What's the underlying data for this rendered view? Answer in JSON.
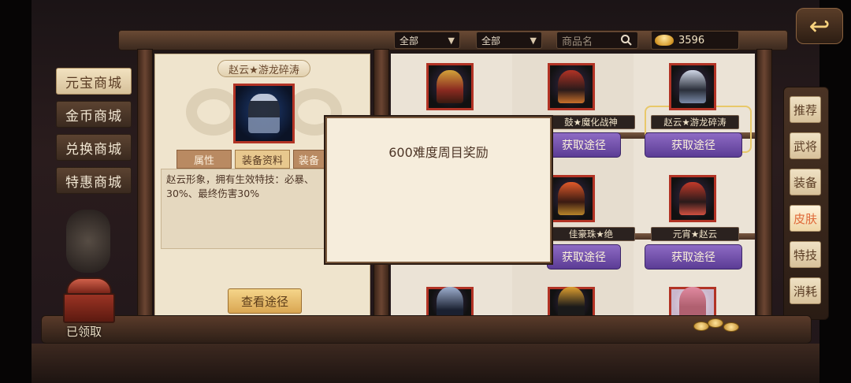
{
  "top": {
    "filter1": "全部",
    "filter2": "全部",
    "search_placeholder": "商品名",
    "currency_amount": "3596"
  },
  "shop_tabs": [
    "元宝商城",
    "金币商城",
    "兑换商城",
    "特惠商城"
  ],
  "active_shop_tab": "元宝商城",
  "detail": {
    "title": "赵云★游龙碎涛",
    "tabs": [
      "属性",
      "装备资料",
      "装备"
    ],
    "description": "赵云形象，拥有生效特技：必暴、\n30%、最终伤害30%",
    "view_button": "查看途径"
  },
  "items": [
    {
      "name": "",
      "button": ""
    },
    {
      "name": "鼓★魔化战神",
      "button": "获取途径"
    },
    {
      "name": "赵云★游龙碎涛",
      "button": "获取途径"
    },
    {
      "name": "",
      "button": ""
    },
    {
      "name": "佳豪珠★绝",
      "button": "获取途径"
    },
    {
      "name": "元宵★赵云",
      "button": "获取途径"
    }
  ],
  "category_tabs": [
    "推荐",
    "武将",
    "装备",
    "皮肤",
    "特技",
    "消耗"
  ],
  "active_category": "皮肤",
  "chest_label": "已领取",
  "modal": {
    "text": "600难度周目奖励"
  },
  "colors": {
    "panel_bg": "#efe4cd",
    "get_button": "#6f4fae",
    "active_category_text": "#e06a3a",
    "icon_border": "#b23325"
  },
  "icons": {
    "back": "back-arrow-icon",
    "search": "search-icon",
    "currency": "gold-ingot-icon"
  }
}
